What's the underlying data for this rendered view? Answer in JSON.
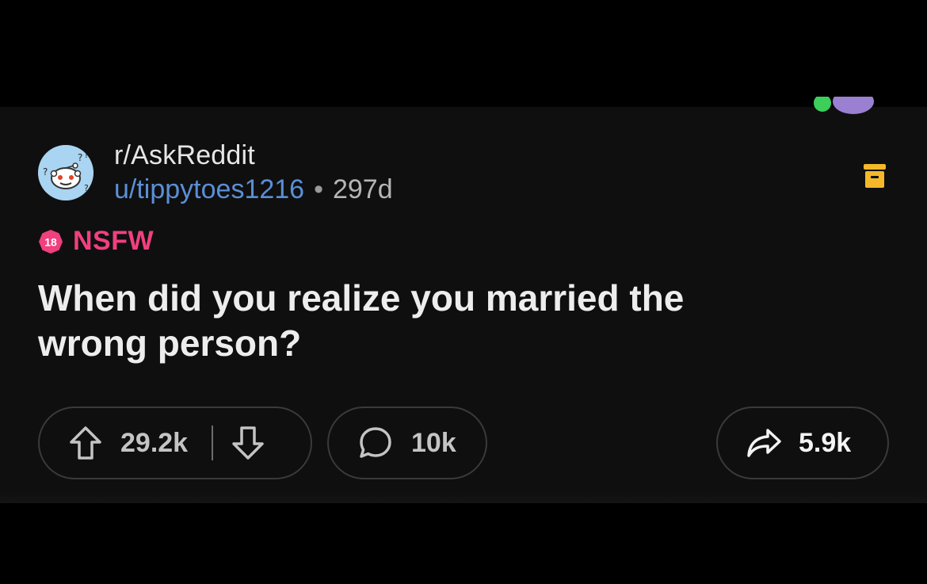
{
  "post": {
    "subreddit": "r/AskReddit",
    "username": "u/tippytoes1216",
    "separator": "•",
    "age": "297d",
    "nsfw_badge_number": "18",
    "nsfw_label": "NSFW",
    "title": "When did you realize you married the wrong person?"
  },
  "actions": {
    "upvotes": "29.2k",
    "comments": "10k",
    "shares": "5.9k"
  },
  "icons": {
    "subreddit_avatar": "askreddit-snoo-icon",
    "save": "save-archive-icon",
    "upvote": "arrow-up-icon",
    "downvote": "arrow-down-icon",
    "comment": "speech-bubble-icon",
    "share": "share-arrow-icon"
  },
  "colors": {
    "background": "#000000",
    "card": "#0f0f10",
    "username": "#5b8fd6",
    "nsfw": "#f0407e",
    "save_icon": "#f5b829",
    "avatar_bg": "#a9d4f2"
  }
}
